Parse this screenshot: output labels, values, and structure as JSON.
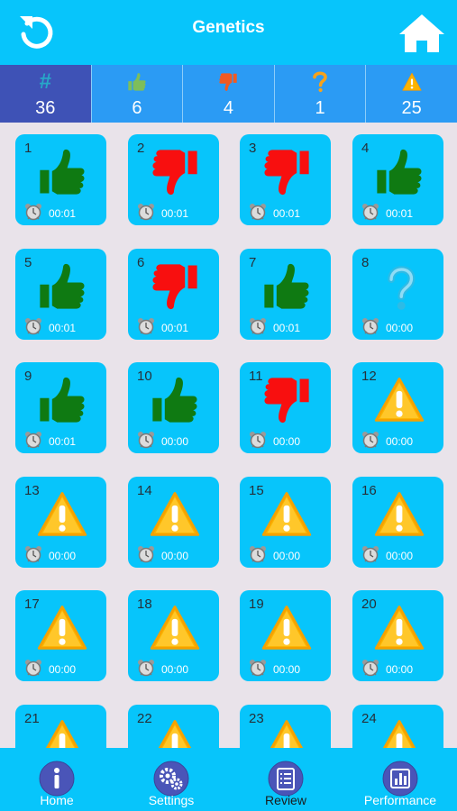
{
  "header": {
    "title": "Genetics"
  },
  "stats": [
    {
      "label": "#",
      "value": "36",
      "icon": "hash-icon"
    },
    {
      "value": "6",
      "icon": "thumbs-up-icon"
    },
    {
      "value": "4",
      "icon": "thumbs-down-icon"
    },
    {
      "value": "1",
      "icon": "question-icon"
    },
    {
      "value": "25",
      "icon": "warning-icon"
    }
  ],
  "questions": [
    {
      "n": "1",
      "status": "correct",
      "time": "00:01"
    },
    {
      "n": "2",
      "status": "wrong",
      "time": "00:01"
    },
    {
      "n": "3",
      "status": "wrong",
      "time": "00:01"
    },
    {
      "n": "4",
      "status": "correct",
      "time": "00:01"
    },
    {
      "n": "5",
      "status": "correct",
      "time": "00:01"
    },
    {
      "n": "6",
      "status": "wrong",
      "time": "00:01"
    },
    {
      "n": "7",
      "status": "correct",
      "time": "00:01"
    },
    {
      "n": "8",
      "status": "unsure",
      "time": "00:00"
    },
    {
      "n": "9",
      "status": "correct",
      "time": "00:01"
    },
    {
      "n": "10",
      "status": "correct",
      "time": "00:00"
    },
    {
      "n": "11",
      "status": "wrong",
      "time": "00:00"
    },
    {
      "n": "12",
      "status": "unanswered",
      "time": "00:00"
    },
    {
      "n": "13",
      "status": "unanswered",
      "time": "00:00"
    },
    {
      "n": "14",
      "status": "unanswered",
      "time": "00:00"
    },
    {
      "n": "15",
      "status": "unanswered",
      "time": "00:00"
    },
    {
      "n": "16",
      "status": "unanswered",
      "time": "00:00"
    },
    {
      "n": "17",
      "status": "unanswered",
      "time": "00:00"
    },
    {
      "n": "18",
      "status": "unanswered",
      "time": "00:00"
    },
    {
      "n": "19",
      "status": "unanswered",
      "time": "00:00"
    },
    {
      "n": "20",
      "status": "unanswered",
      "time": "00:00"
    },
    {
      "n": "21",
      "status": "unanswered",
      "time": ""
    },
    {
      "n": "22",
      "status": "unanswered",
      "time": ""
    },
    {
      "n": "23",
      "status": "unanswered",
      "time": ""
    },
    {
      "n": "24",
      "status": "unanswered",
      "time": ""
    }
  ],
  "tabs": [
    {
      "label": "Home",
      "icon": "info-icon"
    },
    {
      "label": "Settings",
      "icon": "gears-icon"
    },
    {
      "label": "Review",
      "icon": "list-icon",
      "active": true
    },
    {
      "label": "Performance",
      "icon": "bar-chart-icon"
    }
  ],
  "colors": {
    "brand": "#07c5fb",
    "statsBar": "#2b9bf4",
    "statsActive": "#3e52b6",
    "correct": "#0f7a12",
    "wrong": "#f80f0f",
    "warning": "#fbb400"
  }
}
